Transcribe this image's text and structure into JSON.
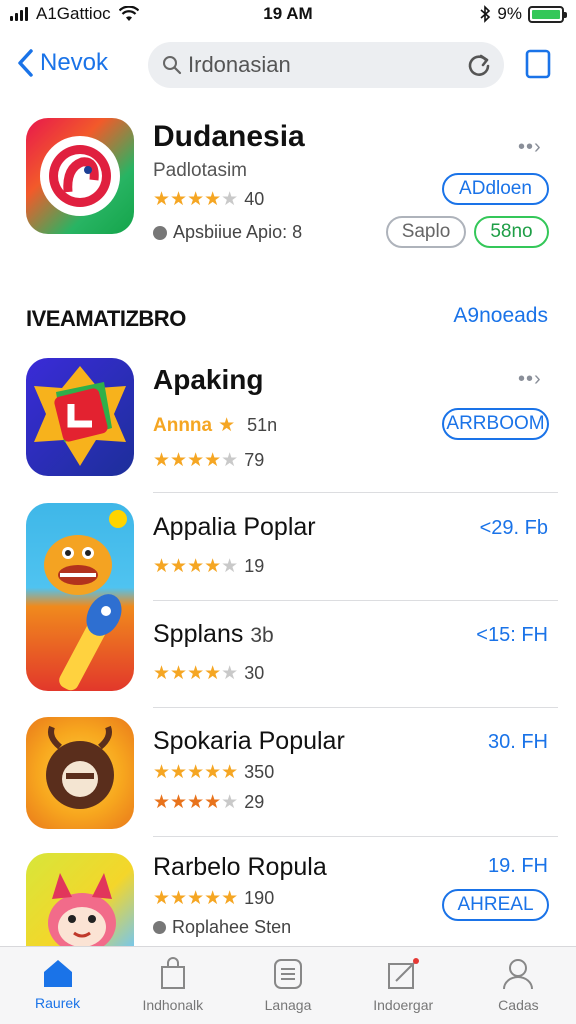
{
  "status_bar": {
    "carrier": "A1Gattioc",
    "time": "19 AM",
    "battery_text": "9%",
    "battery_color": "#34c759"
  },
  "nav": {
    "back_label": "Nevok",
    "search_value": "Irdonasian",
    "search_placeholder": "Irdonasian"
  },
  "featured": {
    "title": "Dudanesia",
    "subtitle": "Padlotasim",
    "rating_count": "40",
    "stars": 4.5,
    "meta": "Apsbiiue Apio: 8",
    "primary_button": "ADdloen",
    "button_secondary": "Saplo",
    "button_green": "58no"
  },
  "section": {
    "title": "IVEAMATIZBRO",
    "link": "A9noeads"
  },
  "apps": [
    {
      "name": "Apaking",
      "rating_label_1": "Annna",
      "rating_count_1": "51n",
      "rating_count_2": "79",
      "button": "ARRBOOM"
    },
    {
      "name": "Appalia Poplar",
      "price": "<29. Fb",
      "rating_count": "19"
    },
    {
      "name": "Spplans",
      "name_suffix": "3b",
      "price": "<15: FH",
      "rating_count": "30"
    },
    {
      "name": "Spokaria Popular",
      "price": "30. FH",
      "rating_count_1": "350",
      "rating_count_2": "29"
    },
    {
      "name": "Rarbelo Ropula",
      "price": "19. FH",
      "rating_count": "190",
      "meta": "Roplahee Sten",
      "button": "AHREAL"
    }
  ],
  "tabs": [
    {
      "label": "Raurek",
      "icon": "home-icon"
    },
    {
      "label": "Indhonalk",
      "icon": "bag-icon"
    },
    {
      "label": "Lanaga",
      "icon": "list-icon"
    },
    {
      "label": "Indoergar",
      "icon": "edit-icon"
    },
    {
      "label": "Cadas",
      "icon": "person-icon"
    }
  ],
  "colors": {
    "accent": "#1a73e8",
    "star": "#f5a623",
    "green": "#34c759"
  }
}
